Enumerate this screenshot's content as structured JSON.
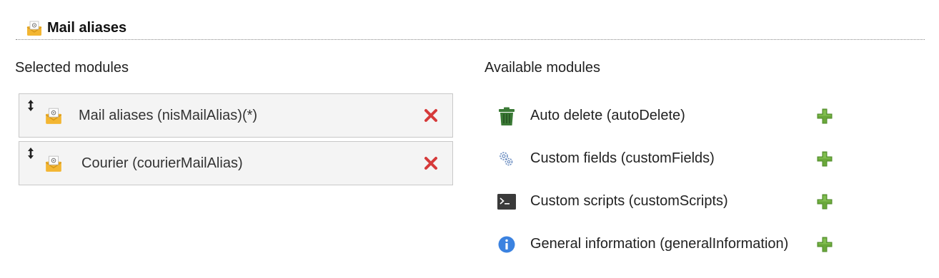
{
  "section": {
    "title": "Mail aliases",
    "icon": "mail-envelope-icon"
  },
  "selected": {
    "heading": "Selected modules",
    "items": [
      {
        "label": "Mail aliases (nisMailAlias)(*)",
        "icon": "mail-envelope-icon"
      },
      {
        "label": "Courier (courierMailAlias)",
        "icon": "mail-envelope-icon"
      }
    ]
  },
  "available": {
    "heading": "Available modules",
    "items": [
      {
        "label": "Auto delete (autoDelete)",
        "icon": "trash-icon"
      },
      {
        "label": "Custom fields (customFields)",
        "icon": "gears-icon"
      },
      {
        "label": "Custom scripts (customScripts)",
        "icon": "terminal-icon"
      },
      {
        "label": "General information (generalInformation)",
        "icon": "info-icon"
      }
    ]
  },
  "colors": {
    "remove": "#d63a3a",
    "add": "#6aa83a",
    "trash": "#3b7a36",
    "info": "#3b82e0",
    "envelope": "#f3b632"
  }
}
